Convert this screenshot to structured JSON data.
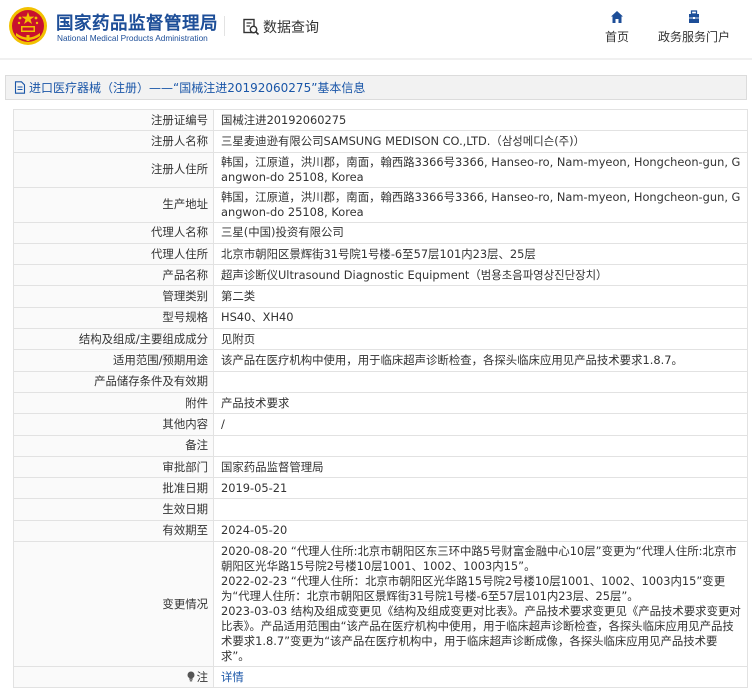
{
  "header": {
    "logo_cn": "国家药品监督管理局",
    "logo_en": "National Medical Products Administration",
    "logo_icon": "national-emblem-icon",
    "query_label": "数据查询",
    "query_icon": "document-search-icon",
    "nav": {
      "home_label": "首页",
      "home_icon": "home-icon",
      "service_label": "政务服务门户",
      "service_icon": "service-portal-icon"
    }
  },
  "section": {
    "title": "进口医疗器械（注册）——“国械注进20192060275”基本信息",
    "icon": "document-icon"
  },
  "colors": {
    "brand_blue": "#1d4e98",
    "link_blue": "#1a56a8",
    "emblem_red": "#c8102e",
    "emblem_gold": "#f2c100"
  },
  "rows": [
    {
      "label": "注册证编号",
      "value": "国械注进20192060275"
    },
    {
      "label": "注册人名称",
      "value": "三星麦迪逊有限公司SAMSUNG MEDISON CO.,LTD.（삼성메디슨(주)）"
    },
    {
      "label": "注册人住所",
      "value": "韩国，江原道，洪川郡，南面，翰西路3366号3366, Hanseo-ro, Nam-myeon, Hongcheon-gun, Gangwon-do 25108, Korea"
    },
    {
      "label": "生产地址",
      "value": "韩国，江原道，洪川郡，南面，翰西路3366号3366, Hanseo-ro, Nam-myeon, Hongcheon-gun, Gangwon-do 25108, Korea"
    },
    {
      "label": "代理人名称",
      "value": "三星(中国)投资有限公司"
    },
    {
      "label": "代理人住所",
      "value": "北京市朝阳区景辉街31号院1号楼-6至57层101内23层、25层"
    },
    {
      "label": "产品名称",
      "value": "超声诊断仪Ultrasound Diagnostic Equipment（범용초음파영상진단장치）"
    },
    {
      "label": "管理类别",
      "value": "第二类"
    },
    {
      "label": "型号规格",
      "value": "HS40、XH40"
    },
    {
      "label": "结构及组成/主要组成成分",
      "value": "见附页"
    },
    {
      "label": "适用范围/预期用途",
      "value": "该产品在医疗机构中使用，用于临床超声诊断检查，各探头临床应用见产品技术要求1.8.7。"
    },
    {
      "label": "产品储存条件及有效期",
      "value": ""
    },
    {
      "label": "附件",
      "value": "产品技术要求"
    },
    {
      "label": "其他内容",
      "value": "/"
    },
    {
      "label": "备注",
      "value": ""
    },
    {
      "label": "审批部门",
      "value": "国家药品监督管理局"
    },
    {
      "label": "批准日期",
      "value": "2019-05-21"
    },
    {
      "label": "生效日期",
      "value": ""
    },
    {
      "label": "有效期至",
      "value": "2024-05-20"
    }
  ],
  "changes": {
    "label": "变更情况",
    "entries": [
      "2020-08-20 “代理人住所:北京市朝阳区东三环中路5号财富金融中心10层”变更为“代理人住所:北京市朝阳区光华路15号院2号楼10层1001、1002、1003内15”。",
      "2022-02-23 “代理人住所：北京市朝阳区光华路15号院2号楼10层1001、1002、1003内15”变更为“代理人住所：北京市朝阳区景辉街31号院1号楼-6至57层101内23层、25层”。",
      "2023-03-03 结构及组成变更见《结构及组成变更对比表》。产品技术要求变更见《产品技术要求变更对比表》。产品适用范围由“该产品在医疗机构中使用，用于临床超声诊断检查，各探头临床应用见产品技术要求1.8.7”变更为“该产品在医疗机构中，用于临床超声诊断成像，各探头临床应用见产品技术要求”。"
    ]
  },
  "note": {
    "label": "注",
    "icon": "lightbulb-icon",
    "link_text": "详情"
  }
}
